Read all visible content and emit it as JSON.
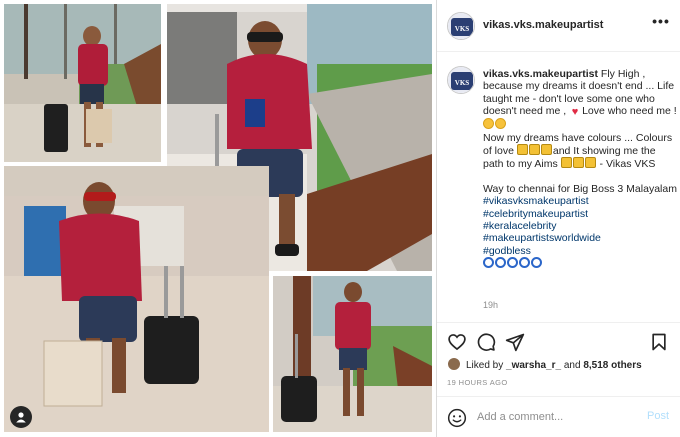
{
  "post": {
    "username": "vikas.vks.makeupartist",
    "more_label": "•••",
    "caption": {
      "username": "vikas.vks.makeupartist",
      "line1": " Fly High , because my dreams it doesn't end ... Life taught me - don't love some one who doesn't need me , ",
      "line1_end": "Love who need me !",
      "line2": "Now my dreams have colours ... Colours of love ",
      "line2_end": "and It showing me the path to my Aims ",
      "line2_sign": " - Vikas VKS",
      "line3": "Way to chennai for Big Boss 3 Malayalam ",
      "hashtags": [
        "#vikasvksmakeupartist",
        "#celebritymakeupartist",
        "#keralacelebrity",
        "#makeupartistsworldwide",
        "#godbless"
      ]
    },
    "time_ago": "19h",
    "liked_by_prefix": "Liked by ",
    "liked_by_user": "_warsha_r_",
    "liked_by_middle": " and ",
    "liked_by_count": "8,518 others",
    "timestamp": "19 HOURS AGO",
    "comment_placeholder": "Add a comment...",
    "post_button": "Post"
  },
  "icons": {
    "like": "heart-icon",
    "comment": "comment-icon",
    "share": "share-icon",
    "save": "bookmark-icon",
    "emoji": "smiley-icon",
    "tagged_user": "user-icon"
  },
  "colors": {
    "link": "#00376b",
    "post_button": "#b2dffc",
    "muted": "#8e8e8e",
    "text": "#262626"
  }
}
